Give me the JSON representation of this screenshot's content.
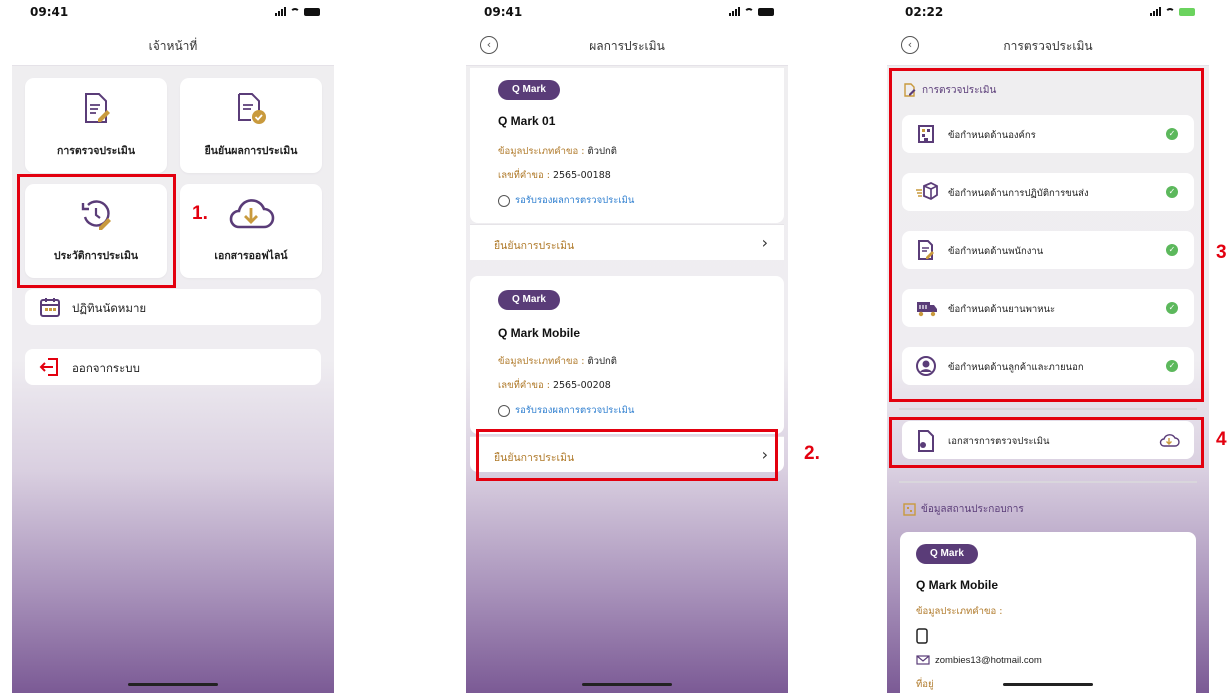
{
  "screen1": {
    "time": "09:41",
    "title": "เจ้าหน้าที่",
    "tiles": [
      {
        "label": "การตรวจประเมิน",
        "icon": "edit-document-icon"
      },
      {
        "label": "ยืนยันผลการประเมิน",
        "icon": "approved-document-icon"
      },
      {
        "label": "ประวัติการประเมิน",
        "icon": "history-edit-icon"
      },
      {
        "label": "เอกสารออฟไลน์",
        "icon": "cloud-download-icon"
      }
    ],
    "rows": [
      {
        "label": "ปฏิทินนัดหมาย",
        "icon": "calendar-icon"
      },
      {
        "label": "ออกจากระบบ",
        "icon": "logout-icon"
      }
    ],
    "marker": "1."
  },
  "screen2": {
    "time": "09:41",
    "title": "ผลการประเมิน",
    "cards": [
      {
        "badge": "Q Mark",
        "name": "Q Mark 01",
        "type_label": "ข้อมูลประเภทคำขอ :",
        "type_value": "ติวปกติ",
        "req_label": "เลขที่คำขอ :",
        "req_value": "2565-00188",
        "status": "รอรับรองผลการตรวจประเมิน",
        "confirm": "ยืนยันการประเมิน"
      },
      {
        "badge": "Q Mark",
        "name": "Q Mark Mobile",
        "type_label": "ข้อมูลประเภทคำขอ :",
        "type_value": "ติวปกติ",
        "req_label": "เลขที่คำขอ :",
        "req_value": "2565-00208",
        "status": "รอรับรองผลการตรวจประเมิน",
        "confirm": "ยืนยันการประเมิน"
      }
    ],
    "marker": "2."
  },
  "screen3": {
    "time": "02:22",
    "title": "การตรวจประเมิน",
    "section_title": "การตรวจประเมิน",
    "requirements": [
      {
        "label": "ข้อกำหนดด้านองค์กร",
        "icon": "building-icon"
      },
      {
        "label": "ข้อกำหนดด้านการปฏิบัติการขนส่ง",
        "icon": "package-icon"
      },
      {
        "label": "ข้อกำหนดด้านพนักงาน",
        "icon": "employee-document-icon"
      },
      {
        "label": "ข้อกำหนดด้านยานพาหนะ",
        "icon": "truck-icon"
      },
      {
        "label": "ข้อกำหนดด้านลูกค้าและภายนอก",
        "icon": "user-circle-icon"
      }
    ],
    "document_row": "เอกสารการตรวจประเมิน",
    "place_section": "ข้อมูลสถานประกอบการ",
    "card": {
      "badge": "Q Mark",
      "name": "Q Mark Mobile",
      "type_label": "ข้อมูลประเภทคำขอ :",
      "email": "zombies13@hotmail.com",
      "address_label": "ที่อยู่"
    },
    "marker3": "3",
    "marker4": "4"
  },
  "colors": {
    "accent": "#5a3c78",
    "highlight": "#e3000f",
    "gold": "#b07a2a",
    "success": "#5cb85c"
  }
}
